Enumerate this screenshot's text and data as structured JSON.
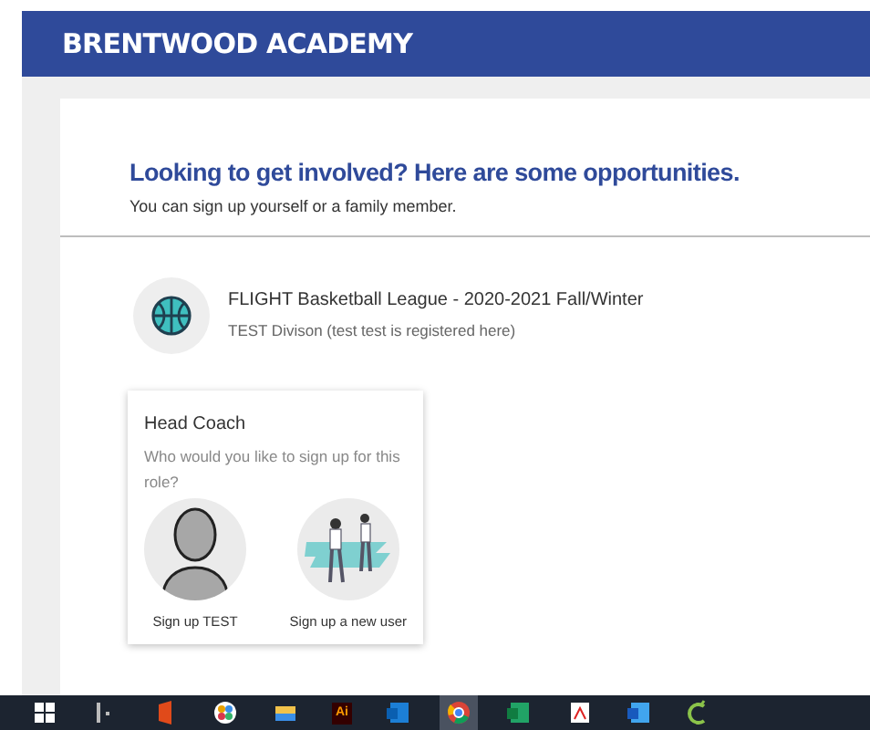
{
  "header": {
    "title": "BRENTWOOD ACADEMY"
  },
  "intro": {
    "title": "Looking to get involved? Here are some opportunities.",
    "subtitle": "You can sign up yourself or a family member."
  },
  "program": {
    "name": "FLIGHT Basketball League - 2020-2021 Fall/Winter",
    "division": "TEST Divison (test test is registered here)"
  },
  "role_card": {
    "title": "Head Coach",
    "question": "Who would you like to sign up for this role?",
    "options": [
      {
        "kind": "person",
        "label": "Sign up TEST"
      },
      {
        "kind": "new_user",
        "label": "Sign up a new user"
      }
    ]
  },
  "taskbar": [
    {
      "kind": "windows",
      "active": false
    },
    {
      "kind": "task_view",
      "active": false
    },
    {
      "kind": "office",
      "active": false
    },
    {
      "kind": "pinwheel",
      "active": false
    },
    {
      "kind": "folder",
      "active": false
    },
    {
      "kind": "letters",
      "text": "Ai",
      "active": false
    },
    {
      "kind": "mail",
      "active": false
    },
    {
      "kind": "browser",
      "active": true
    },
    {
      "kind": "sheet",
      "active": false
    },
    {
      "kind": "pdf",
      "active": false
    },
    {
      "kind": "doc",
      "active": false
    },
    {
      "kind": "sprout",
      "active": false
    }
  ]
}
